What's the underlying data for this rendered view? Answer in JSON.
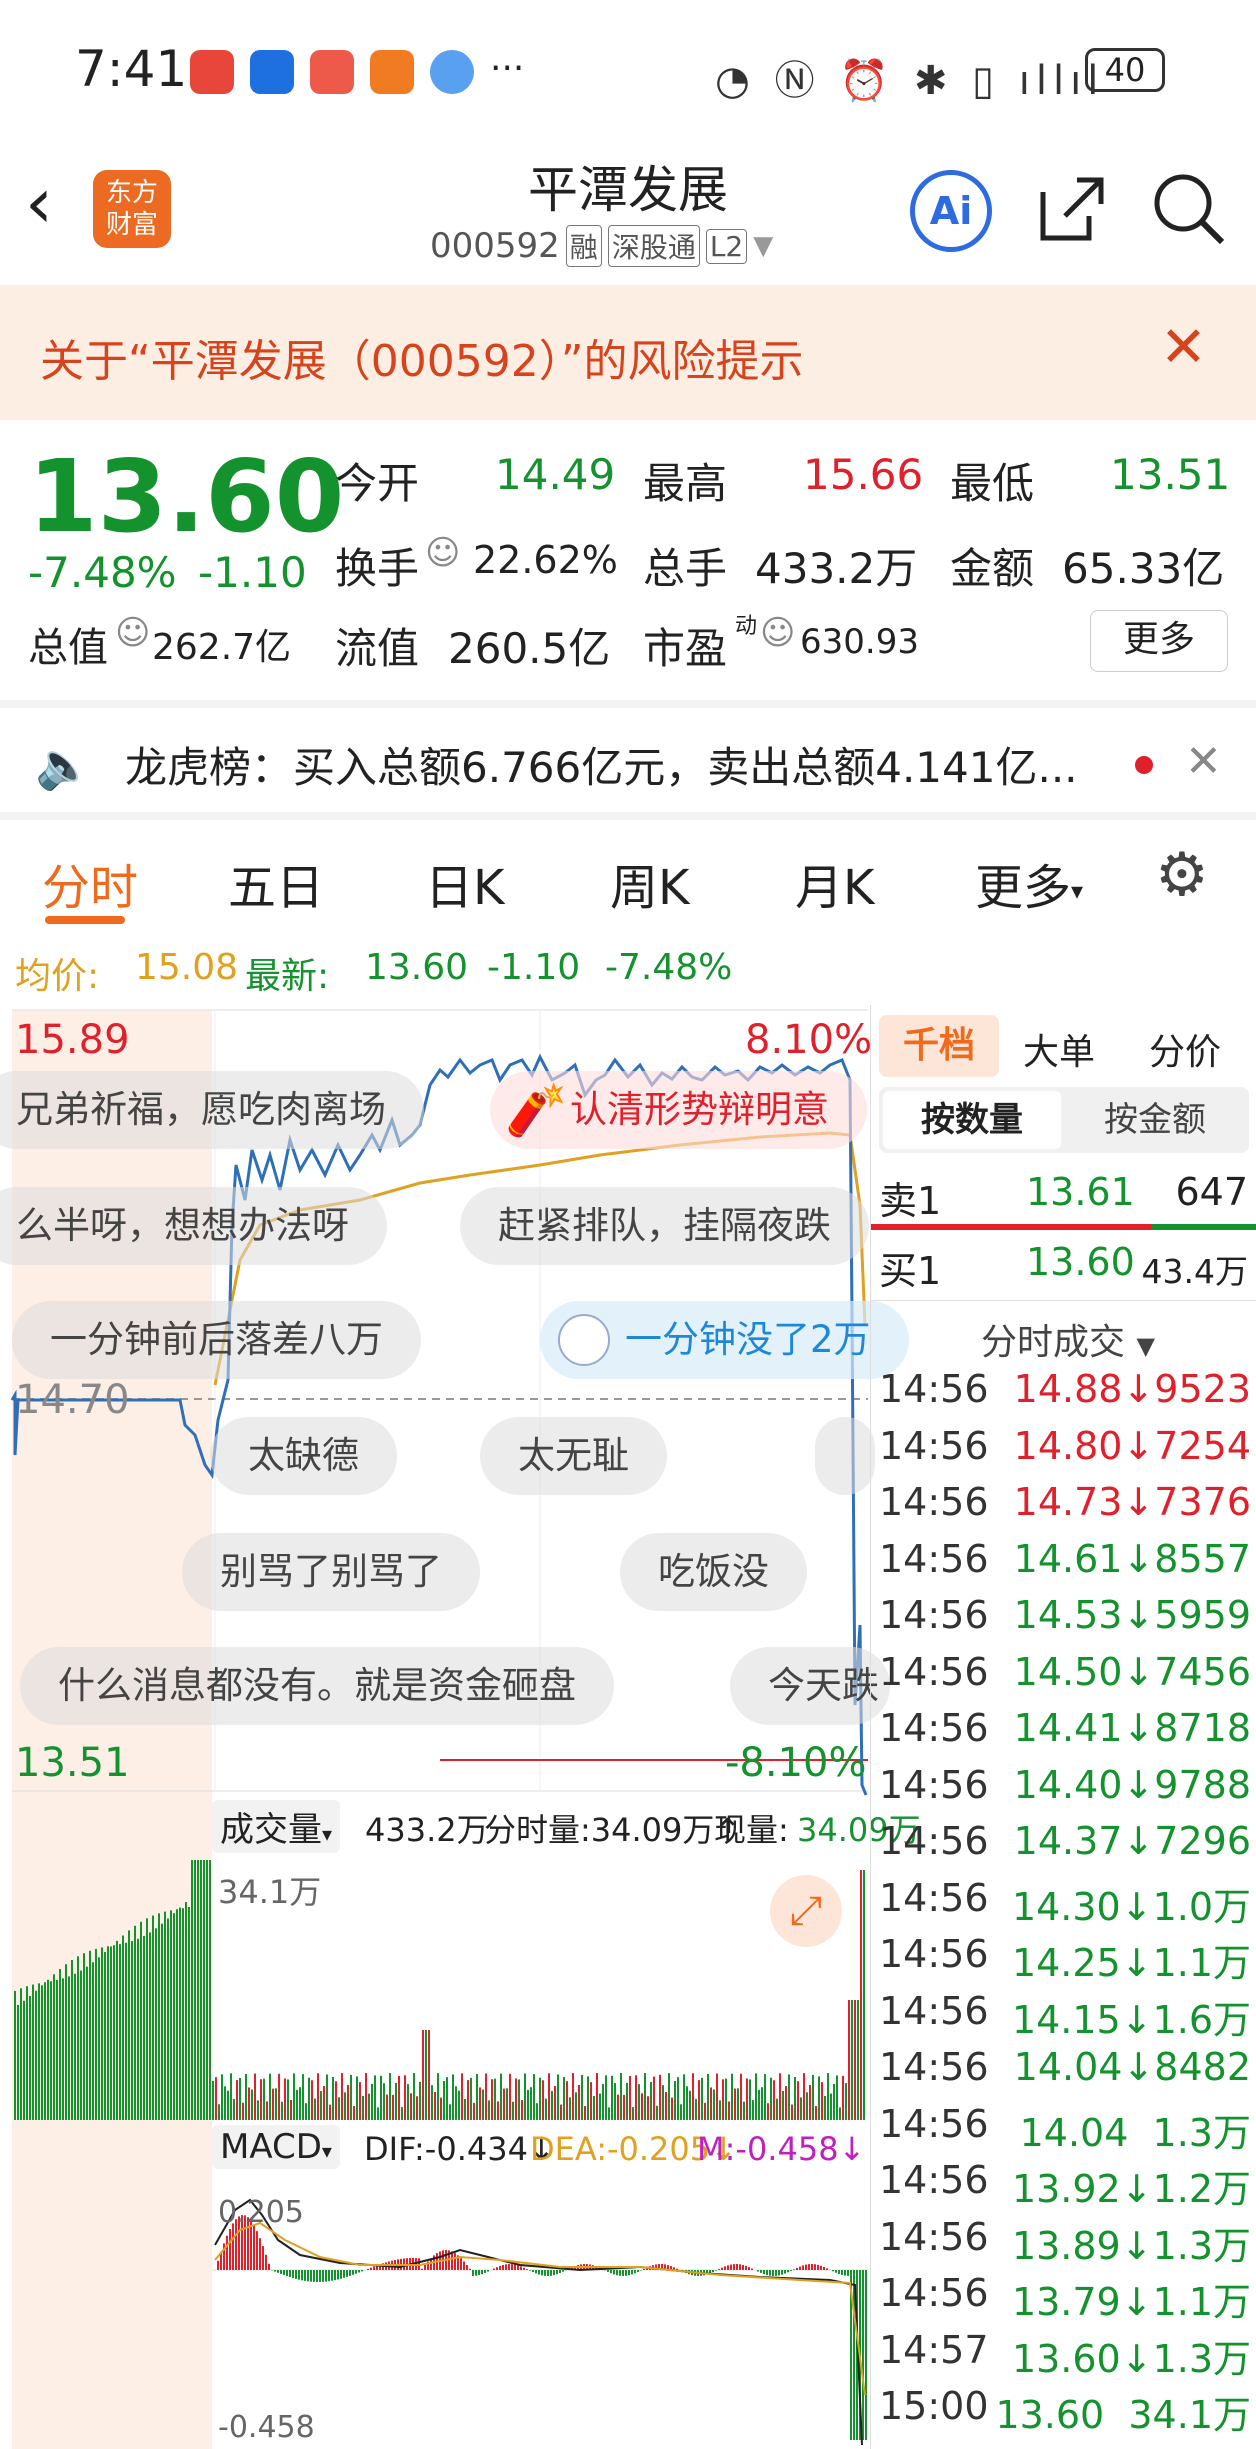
{
  "status": {
    "time": "7:41",
    "more": "···",
    "battery": "40"
  },
  "header": {
    "title": "平潭发展",
    "code": "000592",
    "badges": [
      "融",
      "深股通",
      "L2"
    ],
    "logo": "东方\n财富",
    "ai": "Ai"
  },
  "risk": {
    "text": "关于“平潭发展（000592）”的风险提示"
  },
  "quote": {
    "price": "13.60",
    "change_pct": "-7.48%",
    "change": "-1.10",
    "open_label": "今开",
    "open": "14.49",
    "high_label": "最高",
    "high": "15.66",
    "low_label": "最低",
    "low": "13.51",
    "turnover_label": "换手",
    "turnover": "22.62%",
    "volume_label": "总手",
    "volume": "433.2万",
    "amount_label": "金额",
    "amount": "65.33亿",
    "mcap_label": "总值",
    "mcap": "262.7亿",
    "float_label": "流值",
    "float": "260.5亿",
    "pe_label": "市盈",
    "pe_sup": "动",
    "pe": "630.93",
    "more": "更多"
  },
  "notice": {
    "text": "龙虎榜：买入总额6.766亿元，卖出总额4.141亿..."
  },
  "tabs": [
    "分时",
    "五日",
    "日K",
    "周K",
    "月K",
    "更多"
  ],
  "info": {
    "avg_label": "均价:",
    "avg": "15.08",
    "last_label": "最新:",
    "last": "13.60",
    "chg": "-1.10",
    "pct": "-7.48%"
  },
  "chart": {
    "y_top": "15.89",
    "y_mid": "14.70",
    "y_bottom": "13.51",
    "pct_top": "8.10%",
    "pct_bottom": "-8.10%",
    "vol_label": "成交量",
    "vol_total": "433.2万",
    "vol_minute": "分时量:34.09万↑",
    "vol_now_label": "现量:",
    "vol_now": "34.09万",
    "vol_max": "34.1万",
    "macd_label": "MACD",
    "dif": "DIF:-0.434↓",
    "dea": "DEA:-0.205↓",
    "m": "M:-0.458↓",
    "macd_top": "0.205",
    "macd_bottom": "-0.458"
  },
  "comments": [
    "兄弟祈福，愿吃肉离场",
    "认清形势辩明意",
    "么半呀，想想办法呀",
    "赶紧排队，挂隔夜跌",
    "一分钟前后落差八万",
    "一分钟没了2万",
    "太缺德",
    "太无耻",
    "别骂了别骂了",
    "吃饭没",
    "什么消息都没有。就是资金砸盘",
    "今天跌"
  ],
  "side": {
    "tabs": [
      "千档",
      "大单",
      "分价"
    ],
    "sub": [
      "按数量",
      "按金额"
    ],
    "sell_label": "卖1",
    "sell_price": "13.61",
    "sell_vol": "647",
    "buy_label": "买1",
    "buy_price": "13.60",
    "buy_vol": "43.4万",
    "ticks_title": "分时成交",
    "ticks": [
      {
        "t": "14:56",
        "v": "14.88↓9523",
        "c": "red"
      },
      {
        "t": "14:56",
        "v": "14.80↓7254",
        "c": "red"
      },
      {
        "t": "14:56",
        "v": "14.73↓7376",
        "c": "red"
      },
      {
        "t": "14:56",
        "v": "14.61↓8557",
        "c": "green"
      },
      {
        "t": "14:56",
        "v": "14.53↓5959",
        "c": "green"
      },
      {
        "t": "14:56",
        "v": "14.50↓7456",
        "c": "green"
      },
      {
        "t": "14:56",
        "v": "14.41↓8718",
        "c": "green"
      },
      {
        "t": "14:56",
        "v": "14.40↓9788",
        "c": "green"
      },
      {
        "t": "14:56",
        "v": "14.37↓7296",
        "c": "green"
      },
      {
        "t": "14:56",
        "v": "14.30↓1.0万",
        "c": "green"
      },
      {
        "t": "14:56",
        "v": "14.25↓1.1万",
        "c": "green"
      },
      {
        "t": "14:56",
        "v": "14.15↓1.6万",
        "c": "green"
      },
      {
        "t": "14:56",
        "v": "14.04↓8482",
        "c": "green"
      },
      {
        "t": "14:56",
        "v": "14.04  1.3万",
        "c": "green"
      },
      {
        "t": "14:56",
        "v": "13.92↓1.2万",
        "c": "green"
      },
      {
        "t": "14:56",
        "v": "13.89↓1.3万",
        "c": "green"
      },
      {
        "t": "14:56",
        "v": "13.79↓1.1万",
        "c": "green"
      },
      {
        "t": "14:57",
        "v": "13.60↓1.3万",
        "c": "green"
      },
      {
        "t": "15:00",
        "v": "13.60  34.1万",
        "c": "green"
      }
    ]
  },
  "colors": {
    "up": "#e0202b",
    "down": "#13922e",
    "accent": "#f06a1d",
    "avg": "#e0a020",
    "price_line": "#2f6fb8"
  }
}
